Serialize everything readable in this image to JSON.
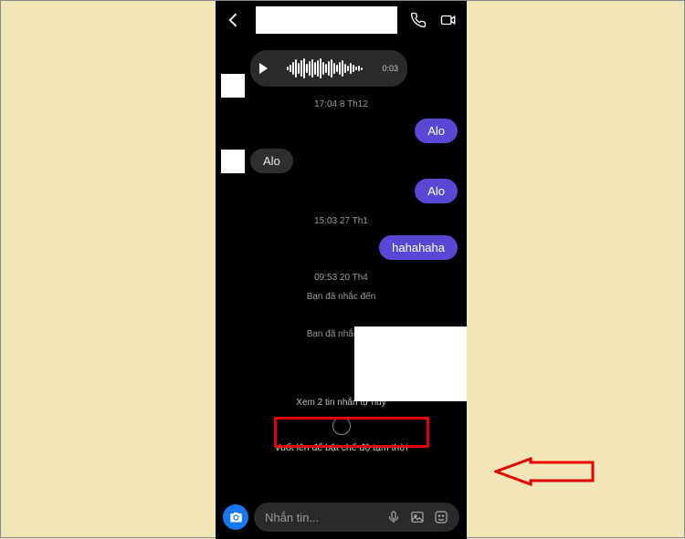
{
  "header": {
    "contact_name": ""
  },
  "voice": {
    "duration": "0:03"
  },
  "timestamps": {
    "t1": "17:04 8 Th12",
    "t2": "15:03 27 Th1",
    "t3": "09:53 20 Th4"
  },
  "messages": {
    "sent1": "Alo",
    "recv1": "Alo",
    "sent2": "Alo",
    "sent3": "hahahaha"
  },
  "system": {
    "reply1": "Bạn đã nhắc đến",
    "reply2": "Bạn đã nhắc đến",
    "view_self_destruct": "Xem 2 tin nhắn tự hủy",
    "swipe_hint": "Vuốt lên để bật chế độ tạm thời"
  },
  "input": {
    "placeholder": "Nhắn tin..."
  },
  "icons": {
    "back": "back-arrow",
    "call": "phone",
    "video": "video-camera",
    "camera": "camera",
    "mic": "microphone",
    "gallery": "image",
    "sticker": "smiley"
  }
}
